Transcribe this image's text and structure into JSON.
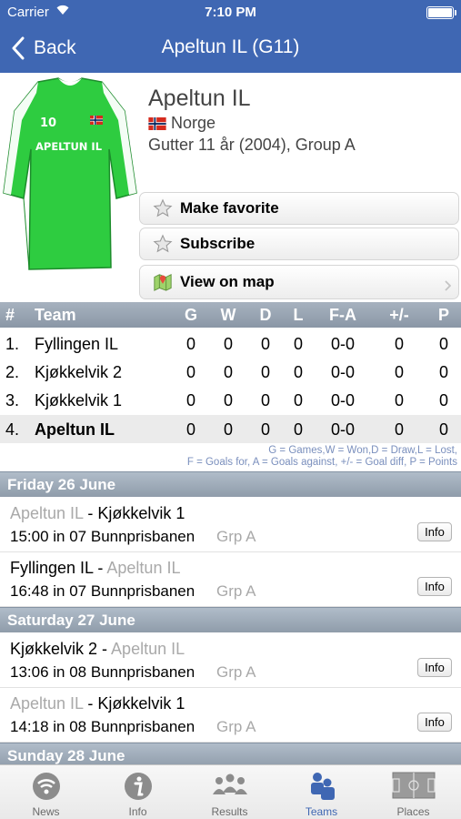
{
  "status_bar": {
    "carrier": "Carrier",
    "time": "7:10 PM"
  },
  "nav": {
    "back_label": "Back",
    "title": "Apeltun IL (G11)"
  },
  "team": {
    "name": "Apeltun IL",
    "country": "Norge",
    "group_line": "Gutter 11 år (2004), Group A",
    "jersey_number": "10",
    "jersey_text": "APELTUN IL"
  },
  "actions": {
    "favorite": "Make favorite",
    "subscribe": "Subscribe",
    "map": "View on map"
  },
  "standings": {
    "headers": {
      "pos": "#",
      "team": "Team",
      "g": "G",
      "w": "W",
      "d": "D",
      "l": "L",
      "fa": "F-A",
      "pm": "+/-",
      "p": "P"
    },
    "rows": [
      {
        "pos": "1.",
        "team": "Fyllingen IL",
        "g": "0",
        "w": "0",
        "d": "0",
        "l": "0",
        "fa": "0-0",
        "pm": "0",
        "p": "0"
      },
      {
        "pos": "2.",
        "team": "Kjøkkelvik 2",
        "g": "0",
        "w": "0",
        "d": "0",
        "l": "0",
        "fa": "0-0",
        "pm": "0",
        "p": "0"
      },
      {
        "pos": "3.",
        "team": "Kjøkkelvik 1",
        "g": "0",
        "w": "0",
        "d": "0",
        "l": "0",
        "fa": "0-0",
        "pm": "0",
        "p": "0"
      },
      {
        "pos": "4.",
        "team": "Apeltun IL",
        "g": "0",
        "w": "0",
        "d": "0",
        "l": "0",
        "fa": "0-0",
        "pm": "0",
        "p": "0"
      }
    ],
    "legend_line1": "G = Games,W = Won,D = Draw,L = Lost,",
    "legend_line2": "F = Goals for, A = Goals against, +/- = Goal diff, P = Points"
  },
  "schedule": {
    "day1": "Friday 26 June",
    "day2": "Saturday 27 June",
    "day3": "Sunday 28 June",
    "matches": [
      {
        "home": "Apeltun IL",
        "sep": " - ",
        "away": "Kjøkkelvik 1",
        "when": "15:00 in 07 Bunnprisbanen",
        "group": "Grp A",
        "info": "Info"
      },
      {
        "home": "Fyllingen IL",
        "sep": " - ",
        "away": "Apeltun IL",
        "when": "16:48 in 07 Bunnprisbanen",
        "group": "Grp A",
        "info": "Info"
      },
      {
        "home": "Kjøkkelvik 2",
        "sep": " - ",
        "away": "Apeltun IL",
        "when": "13:06 in 08 Bunnprisbanen",
        "group": "Grp A",
        "info": "Info"
      },
      {
        "home": "Apeltun IL",
        "sep": " - ",
        "away": "Kjøkkelvik 1",
        "when": "14:18 in 08 Bunnprisbanen",
        "group": "Grp A",
        "info": "Info"
      }
    ]
  },
  "tabs": {
    "news": "News",
    "info": "Info",
    "results": "Results",
    "teams": "Teams",
    "places": "Places"
  },
  "colors": {
    "nav_bar": "#3f67b3",
    "jersey": "#2ecc40",
    "section_header": "#9aa7b5",
    "active_tab": "#3f67b3",
    "legend_text": "#7a8fbd"
  }
}
